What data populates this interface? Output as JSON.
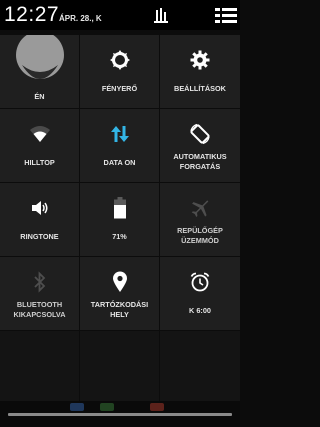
{
  "status_bar": {
    "time": "12:27",
    "date": "ÁPR. 28., K"
  },
  "tiles": [
    {
      "id": "user",
      "label": "ÉN",
      "icon": "user-avatar-icon"
    },
    {
      "id": "brightness",
      "label": "FÉNYERŐ",
      "icon": "brightness-icon"
    },
    {
      "id": "settings",
      "label": "BEÁLLÍTÁSOK",
      "icon": "gear-icon"
    },
    {
      "id": "wifi",
      "label": "HILLTOP",
      "icon": "wifi-icon"
    },
    {
      "id": "data",
      "label": "DATA ON",
      "icon": "data-arrows-icon"
    },
    {
      "id": "rotate",
      "label": "AUTOMATIKUS FORGATÁS",
      "icon": "auto-rotate-icon"
    },
    {
      "id": "ringtone",
      "label": "RINGTONE",
      "icon": "speaker-icon"
    },
    {
      "id": "battery",
      "label": "71%",
      "icon": "battery-icon"
    },
    {
      "id": "airplane",
      "label": "REPÜLŐGÉP ÜZEMMÓD",
      "icon": "airplane-icon"
    },
    {
      "id": "bluetooth",
      "label": "BLUETOOTH KIKAPCSOLVA",
      "icon": "bluetooth-icon"
    },
    {
      "id": "location",
      "label": "TARTÓZKODÁSI HELY",
      "icon": "location-pin-icon"
    },
    {
      "id": "alarm",
      "label": "K 6:00",
      "icon": "alarm-clock-icon"
    }
  ],
  "battery_level": 0.71,
  "colors": {
    "tile_bg": "#1f1f1f",
    "accent_blue": "#33b5e5",
    "icon_white": "#ffffff",
    "icon_dim": "#5a5a5a"
  }
}
